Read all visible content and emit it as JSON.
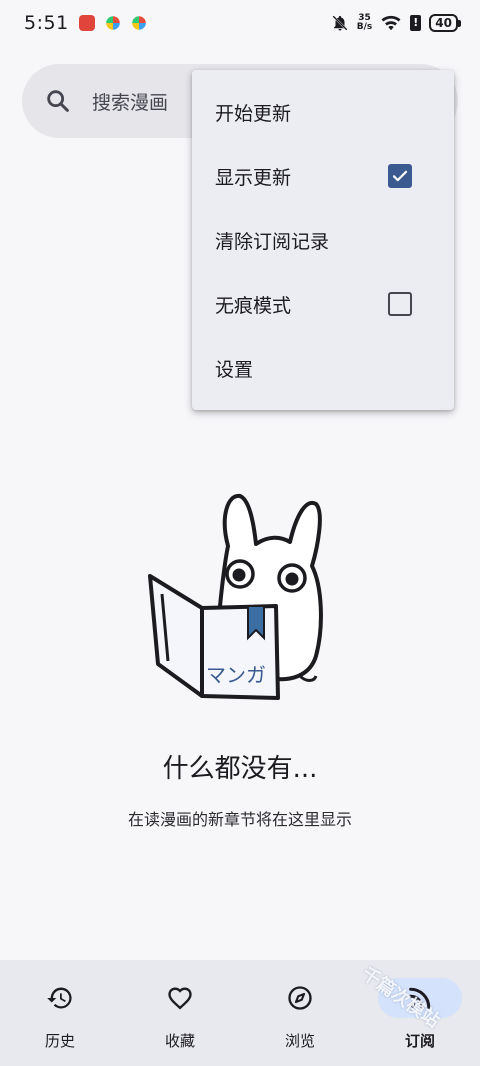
{
  "status_bar": {
    "time": "5:51",
    "net_speed_value": "35",
    "net_speed_unit": "B/s",
    "battery": "40"
  },
  "search": {
    "placeholder": "搜索漫画"
  },
  "menu": {
    "items": [
      {
        "label": "开始更新"
      },
      {
        "label": "显示更新",
        "checked": true
      },
      {
        "label": "清除订阅记录"
      },
      {
        "label": "无痕模式",
        "checked": false
      },
      {
        "label": "设置"
      }
    ]
  },
  "empty_state": {
    "book_text": "マンガ",
    "title": "什么都没有...",
    "subtitle": "在读漫画的新章节将在这里显示"
  },
  "bottom_nav": {
    "items": [
      {
        "label": "历史",
        "icon": "history-icon"
      },
      {
        "label": "收藏",
        "icon": "heart-icon"
      },
      {
        "label": "浏览",
        "icon": "compass-icon"
      },
      {
        "label": "订阅",
        "icon": "rss-icon",
        "active": true
      }
    ]
  },
  "watermark": "千篇次模站",
  "colors": {
    "accent": "#3a5a90",
    "active_pill": "#d4e2fb",
    "nav_bg": "#e8e9ee",
    "menu_bg": "#ecedf2"
  }
}
